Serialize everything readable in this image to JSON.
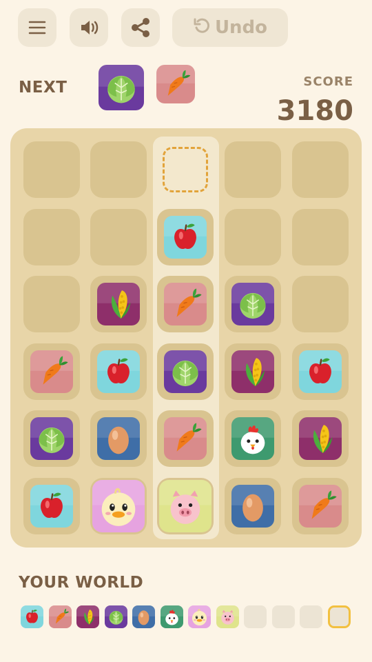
{
  "toolbar": {
    "menu_icon": "menu-icon",
    "sound_icon": "speaker-icon",
    "share_icon": "share-icon",
    "undo_label": "Undo",
    "undo_icon": "undo-icon"
  },
  "next": {
    "label": "NEXT",
    "tiles": [
      "cabbage",
      "carrot"
    ]
  },
  "score": {
    "label": "SCORE",
    "value": "3180"
  },
  "board": {
    "columns": 5,
    "rows": 6,
    "drop_column": 2,
    "grid": [
      [
        null,
        null,
        "drop-target",
        null,
        null
      ],
      [
        null,
        null,
        "apple",
        null,
        null
      ],
      [
        null,
        "corn",
        "carrot",
        "cabbage",
        null
      ],
      [
        "carrot",
        "apple",
        "cabbage",
        "corn",
        "apple"
      ],
      [
        "cabbage",
        "egg",
        "carrot",
        "chicken",
        "corn"
      ],
      [
        "apple",
        "chick",
        "pig",
        "egg",
        "carrot"
      ]
    ]
  },
  "world": {
    "label": "YOUR WORLD",
    "items": [
      "apple",
      "carrot",
      "corn",
      "cabbage",
      "egg",
      "chicken",
      "chick",
      "pig",
      null,
      null,
      null,
      "goal"
    ]
  },
  "colors": {
    "apple": "#7fd6dd",
    "carrot": "#d98b8b",
    "corn": "#8e2f6a",
    "cabbage": "#6a3a9e",
    "egg": "#3f6ea7",
    "chicken": "#3e9a6f",
    "chick": "#e6a3e0",
    "pig": "#dfe48c"
  }
}
